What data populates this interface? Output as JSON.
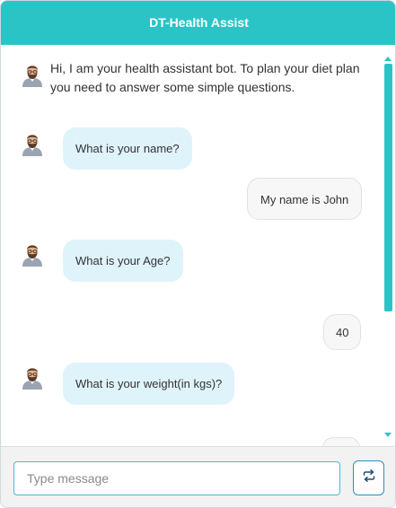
{
  "header": {
    "title": "DT-Health Assist"
  },
  "conversation": {
    "welcome": "Hi, I am your health assistant bot. To plan your diet plan you need to answer some simple questions.",
    "messages": [
      {
        "from": "bot",
        "text": "What is your name?"
      },
      {
        "from": "user",
        "text": "My name is John"
      },
      {
        "from": "bot",
        "text": "What is your Age?"
      },
      {
        "from": "user",
        "text": "40"
      },
      {
        "from": "bot",
        "text": "What is your weight(in kgs)?"
      }
    ]
  },
  "composer": {
    "placeholder": "Type message"
  },
  "icons": {
    "avatar": "bot-avatar-icon",
    "send": "refresh-send-icon"
  },
  "colors": {
    "accent": "#2bc4c6",
    "bot_bubble": "#dff3fb",
    "user_bubble": "#f7f7f7",
    "input_border": "#4bb8d4"
  }
}
